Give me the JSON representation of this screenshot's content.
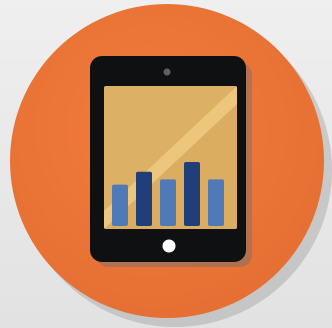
{
  "icon": {
    "name": "tablet-chart-icon",
    "colors": {
      "background": "#e8e8e8",
      "circle": "#ee7435",
      "shadow": "#8f8f8f",
      "device_body": "#0f1012",
      "screen": "#ddb165",
      "screen_glare": "#edc97f",
      "bar_primary": "#4f79b7",
      "bar_dark": "#1f3e7a",
      "home_button": "#ffffff"
    }
  },
  "chart_data": {
    "type": "bar",
    "values": [
      0.55,
      0.72,
      0.62,
      0.85,
      0.62
    ]
  }
}
